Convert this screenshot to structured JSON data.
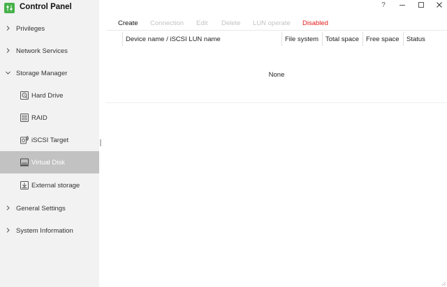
{
  "app": {
    "title": "Control Panel",
    "accent_color": "#47b14a"
  },
  "window_controls": {
    "help": "?",
    "minimize": "–",
    "maximize": "☐",
    "close": "✕"
  },
  "sidebar": {
    "items": [
      {
        "label": "Privileges",
        "icon": "chevron-right-icon"
      },
      {
        "label": "Network Services",
        "icon": "chevron-right-icon"
      },
      {
        "label": "Storage Manager",
        "icon": "chevron-down-icon",
        "expanded": true
      },
      {
        "label": "General Settings",
        "icon": "chevron-right-icon"
      },
      {
        "label": "System Information",
        "icon": "chevron-right-icon"
      }
    ],
    "storage_subitems": [
      {
        "label": "Hard Drive",
        "icon": "hard-drive-icon"
      },
      {
        "label": "RAID",
        "icon": "raid-icon"
      },
      {
        "label": "iSCSI Target",
        "icon": "iscsi-target-icon"
      },
      {
        "label": "Virtual Disk",
        "icon": "virtual-disk-icon",
        "active": true
      },
      {
        "label": "External storage",
        "icon": "external-storage-icon"
      }
    ],
    "active_bg": "#c2c2c2"
  },
  "toolbar": {
    "create": "Create",
    "connection": "Connection",
    "edit": "Edit",
    "delete": "Delete",
    "lun_operate": "LUN operate",
    "status": "Disabled",
    "status_color": "#e21b1b"
  },
  "table": {
    "columns": [
      "Device name / iSCSI LUN name",
      "File system",
      "Total space",
      "Free space",
      "Status"
    ],
    "empty_text": "None",
    "rows": []
  }
}
